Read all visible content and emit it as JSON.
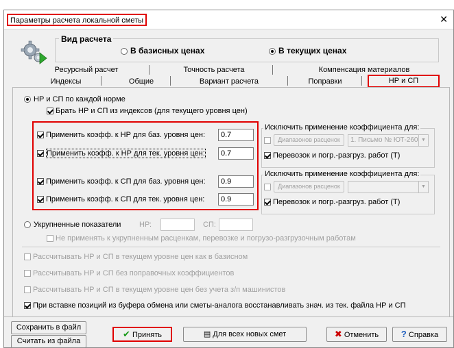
{
  "window": {
    "title": "Параметры расчета локальной сметы",
    "close": "✕"
  },
  "calc_type": {
    "label": "Вид расчета",
    "option_base": "В базисных ценах",
    "option_current": "В текущих ценах",
    "selected": "current"
  },
  "tabs_row1": [
    "Ресурсный расчет",
    "Точность расчета",
    "Компенсация материалов"
  ],
  "tabs_row2": [
    "Индексы",
    "Общие",
    "Вариант расчета",
    "Поправки",
    "НР и СП"
  ],
  "active_tab": "НР и СП",
  "hr_sp": {
    "per_norm_label": "НР и СП по каждой норме",
    "from_indexes_label": "Брать НР и СП из индексов (для текущего уровня цен)",
    "nr_base_label": "Применить коэфф. к НР для баз. уровня цен:",
    "nr_base_value": "0.7",
    "nr_curr_label": "Применить коэфф. к НР для тек. уровня цен:",
    "nr_curr_value": "0.7",
    "sp_base_label": "Применить коэфф. к СП для баз. уровня цен:",
    "sp_base_value": "0.9",
    "sp_curr_label": "Применить коэфф. к СП для тек. уровня цен:",
    "sp_curr_value": "0.9",
    "exclude1_title": "Исключить применение коэффициента для:",
    "exclude1_ranges_button": "Диапазонов расценок",
    "exclude1_combo_value": "1. Письмо № ЮТ-260",
    "exclude1_transport_label": "Перевозок и погр.-разгруз. работ (Т)",
    "exclude2_title": "Исключить применение коэффициента для:",
    "exclude2_ranges_button": "Диапазонов расценок",
    "exclude2_combo_value": "",
    "exclude2_transport_label": "Перевозок и погр.-разгруз. работ (Т)",
    "aggregated_label": "Укрупненные показатели",
    "hr_label": "НР:",
    "sp_label": "СП:",
    "hr_value": "",
    "sp_value": "",
    "not_apply_aggregated_label": "Не применять к укрупненным расценкам, перевозке и погрузо-разгрузочным работам",
    "calc_current_as_base": "Рассчитывать НР и СП в текущем уровне цен как в базисном",
    "calc_without_corrections": "Рассчитывать НР и СП без поправочных коэффициентов",
    "calc_without_machinists": "Рассчитывать НР и СП в текущем уровне цен без учета з/п машинистов",
    "restore_on_paste": "При вставке позиций из буфера обмена или сметы-аналога восстанавливать знач. из тек. файла НР и СП"
  },
  "footer": {
    "save_to_file": "Сохранить в файл",
    "load_from_file": "Считать из файла",
    "accept": "Принять",
    "for_all_new": "Для всех новых смет",
    "cancel": "Отменить",
    "help": "Справка"
  },
  "colors": {
    "highlight": "#e00000",
    "accept_icon": "#1a9a1a",
    "cancel_icon": "#cc0000",
    "help_icon": "#1f5fbf"
  }
}
